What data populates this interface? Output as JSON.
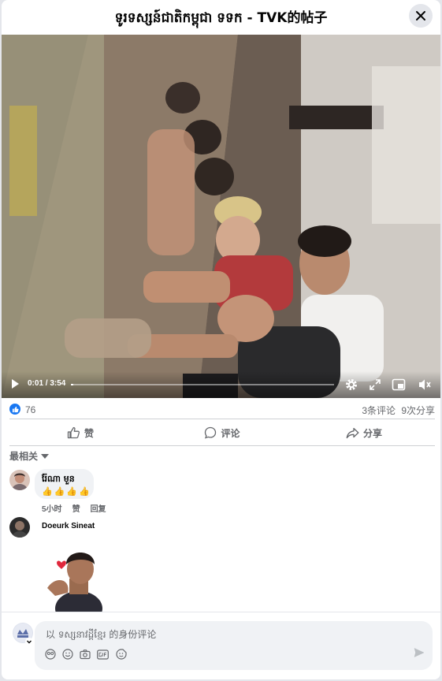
{
  "header": {
    "title": "ទូរទស្សន៍ជាតិកម្ពុជា ទទក - TVK的帖子"
  },
  "video": {
    "time_label": "0:01 / 3:54",
    "progress_fraction": 0.004
  },
  "stats": {
    "likes": "76",
    "comments": "3条评论",
    "shares": "9次分享"
  },
  "actions": {
    "like": "赞",
    "comment": "评论",
    "share": "分享"
  },
  "sort_label": "最相关",
  "comments": [
    {
      "author": "រ៉ែណា មួន",
      "text": "👍👍👍👍",
      "time": "5小时",
      "like": "赞",
      "reply": "回复"
    },
    {
      "author": "Doeurk Sineat"
    }
  ],
  "composer": {
    "placeholder": "以 ទស្សនាវដ្តីខ្មែរ 的身份评论"
  },
  "colors": {
    "accent": "#1877f2",
    "muted": "#65676b",
    "bubble": "#f0f2f5"
  }
}
